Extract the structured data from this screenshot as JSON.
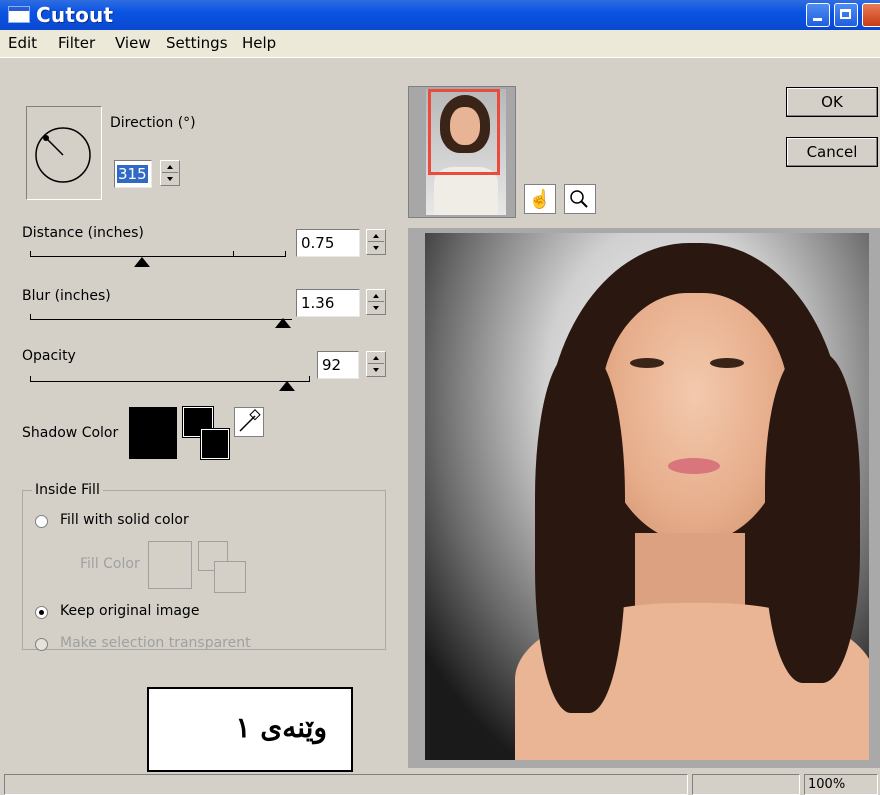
{
  "window": {
    "title": "Cutout"
  },
  "menu": {
    "items": [
      "Edit",
      "Filter",
      "View",
      "Settings",
      "Help"
    ]
  },
  "direction": {
    "label": "Direction (°)",
    "value": "315"
  },
  "distance": {
    "label": "Distance (inches)",
    "value": "0.75"
  },
  "blur": {
    "label": "Blur (inches)",
    "value": "1.36"
  },
  "opacity": {
    "label": "Opacity",
    "value": "92"
  },
  "shadow_color": {
    "label": "Shadow Color",
    "color": "#000000"
  },
  "inside_fill": {
    "legend": "Inside Fill",
    "fill_solid_label": "Fill with solid color",
    "fill_color_label": "Fill Color",
    "keep_original_label": "Keep original image",
    "make_transparent_label": "Make selection transparent"
  },
  "buttons": {
    "ok": "OK",
    "cancel": "Cancel"
  },
  "caption": {
    "text": "وێنەی ١"
  },
  "status": {
    "zoom": "100%"
  },
  "icons": {
    "pan": "hand-icon",
    "zoom": "magnifier-icon",
    "eyedropper": "eyedropper-icon"
  },
  "colors": {
    "titlebar": "#0a54e3",
    "thumbnail_border": "#e74c3c"
  }
}
